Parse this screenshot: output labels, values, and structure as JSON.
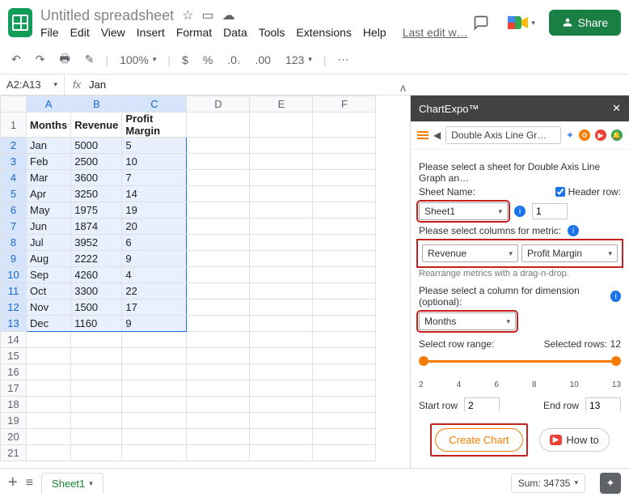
{
  "doc_title": "Untitled spreadsheet",
  "menus": [
    "File",
    "Edit",
    "View",
    "Insert",
    "Format",
    "Data",
    "Tools",
    "Extensions",
    "Help"
  ],
  "last_edit": "Last edit w…",
  "share": "Share",
  "toolbar": {
    "zoom": "100%",
    "currency": "$",
    "pct": "%",
    "dec1": ".0",
    "dec2": ".00",
    "numfmt": "123"
  },
  "namebox": "A2:A13",
  "formula": "Jan",
  "columns": [
    "A",
    "B",
    "C",
    "D",
    "E",
    "F"
  ],
  "headers": {
    "A": "Months",
    "B": "Revenue",
    "C": "Profit Margin"
  },
  "rows": [
    {
      "n": "1",
      "A": "Months",
      "B": "Revenue",
      "C": "Profit Margin"
    },
    {
      "n": "2",
      "A": "Jan",
      "B": "5000",
      "C": "5"
    },
    {
      "n": "3",
      "A": "Feb",
      "B": "2500",
      "C": "10"
    },
    {
      "n": "4",
      "A": "Mar",
      "B": "3600",
      "C": "7"
    },
    {
      "n": "5",
      "A": "Apr",
      "B": "3250",
      "C": "14"
    },
    {
      "n": "6",
      "A": "May",
      "B": "1975",
      "C": "19"
    },
    {
      "n": "7",
      "A": "Jun",
      "B": "1874",
      "C": "20"
    },
    {
      "n": "8",
      "A": "Jul",
      "B": "3952",
      "C": "6"
    },
    {
      "n": "9",
      "A": "Aug",
      "B": "2222",
      "C": "9"
    },
    {
      "n": "10",
      "A": "Sep",
      "B": "4260",
      "C": "4"
    },
    {
      "n": "11",
      "A": "Oct",
      "B": "3300",
      "C": "22"
    },
    {
      "n": "12",
      "A": "Nov",
      "B": "1500",
      "C": "17"
    },
    {
      "n": "13",
      "A": "Dec",
      "B": "1160",
      "C": "9"
    },
    {
      "n": "14"
    },
    {
      "n": "15"
    },
    {
      "n": "16"
    },
    {
      "n": "17"
    },
    {
      "n": "18"
    },
    {
      "n": "19"
    },
    {
      "n": "20"
    },
    {
      "n": "21"
    }
  ],
  "panel": {
    "title": "ChartExpo™",
    "chart_type": "Double Axis Line Gr…",
    "instruction": "Please select a sheet for Double Axis Line Graph an…",
    "sheet_label": "Sheet Name:",
    "header_row_label": "Header row:",
    "header_row_value": "1",
    "sheet_name": "Sheet1",
    "metric_label": "Please select columns for metric:",
    "metric1": "Revenue",
    "metric2": "Profit Margin",
    "rearrange": "Rearrange metrics with a drag-n-drop.",
    "dim_label": "Please select a column for dimension (optional):",
    "dimension": "Months",
    "range_label": "Select row range:",
    "selected_rows": "Selected rows: 12",
    "ticks": [
      "2",
      "4",
      "6",
      "8",
      "10",
      "13"
    ],
    "start_label": "Start row",
    "start_val": "2",
    "end_label": "End row",
    "end_val": "13",
    "create": "Create Chart",
    "howto": "How to"
  },
  "bottom": {
    "sheet": "Sheet1",
    "sum": "Sum: 34735"
  }
}
